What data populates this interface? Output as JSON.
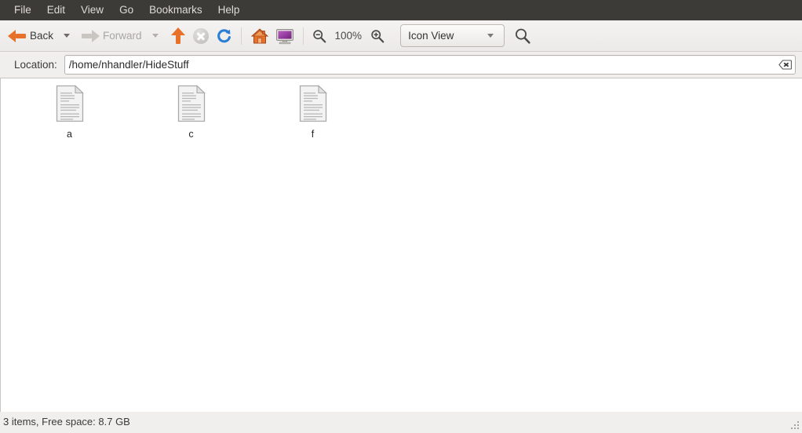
{
  "menubar": {
    "items": [
      {
        "label": "File",
        "name": "menu-file"
      },
      {
        "label": "Edit",
        "name": "menu-edit"
      },
      {
        "label": "View",
        "name": "menu-view"
      },
      {
        "label": "Go",
        "name": "menu-go"
      },
      {
        "label": "Bookmarks",
        "name": "menu-bookmarks"
      },
      {
        "label": "Help",
        "name": "menu-help"
      }
    ]
  },
  "toolbar": {
    "back_label": "Back",
    "back_icon": "arrow-left-icon",
    "back_dropdown_icon": "chevron-down-icon",
    "forward_label": "Forward",
    "forward_icon": "arrow-right-icon",
    "forward_dropdown_icon": "chevron-down-icon",
    "up_icon": "arrow-up-icon",
    "stop_icon": "stop-icon",
    "reload_icon": "reload-icon",
    "home_icon": "home-icon",
    "computer_icon": "computer-icon",
    "zoom_out_icon": "zoom-out-icon",
    "zoom_level": "100%",
    "zoom_in_icon": "zoom-in-icon",
    "view_mode": "Icon View",
    "view_dropdown_icon": "chevron-down-icon",
    "search_icon": "search-icon",
    "colors": {
      "accent_orange": "#e8712a",
      "reload_blue": "#2a7fd4",
      "computer_purple": "#9b3fa0",
      "disabled_grey": "#c9c6c2"
    }
  },
  "location": {
    "label": "Location:",
    "value": "/home/nhandler/HideStuff",
    "placeholder": "Location",
    "clear_icon": "clear-text-icon"
  },
  "files": [
    {
      "name": "a",
      "icon": "text-document-icon"
    },
    {
      "name": "c",
      "icon": "text-document-icon"
    },
    {
      "name": "f",
      "icon": "text-document-icon"
    }
  ],
  "statusbar": {
    "text": "3 items, Free space: 8.7 GB",
    "item_count": 3,
    "free_space": "8.7 GB",
    "resize_grip_icon": "resize-grip-icon"
  }
}
